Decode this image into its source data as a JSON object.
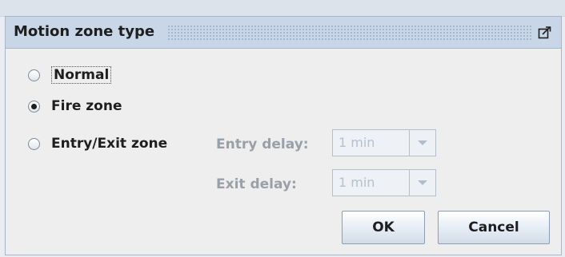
{
  "dialog": {
    "title": "Motion zone type",
    "maximize_icon": "maximize-icon"
  },
  "options": [
    {
      "label": "Normal",
      "checked": false,
      "focused": true
    },
    {
      "label": "Fire zone",
      "checked": true,
      "focused": false
    },
    {
      "label": "Entry/Exit zone",
      "checked": false,
      "focused": false
    }
  ],
  "entry_delay": {
    "label": "Entry delay:",
    "value": "1 min",
    "enabled": false
  },
  "exit_delay": {
    "label": "Exit delay:",
    "value": "1 min",
    "enabled": false
  },
  "buttons": {
    "ok": "OK",
    "cancel": "Cancel"
  }
}
